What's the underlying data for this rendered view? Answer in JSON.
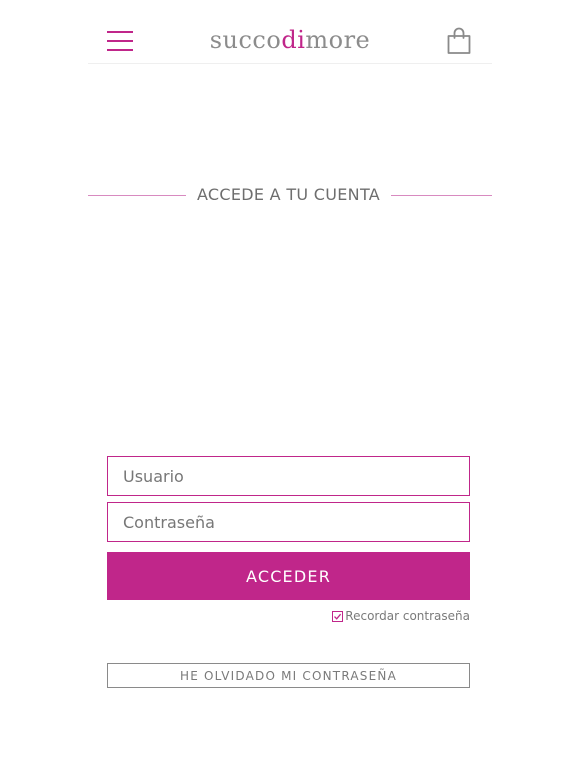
{
  "header": {
    "logo_part1": "succo",
    "logo_part2": "di",
    "logo_part3": "more"
  },
  "login": {
    "heading": "ACCEDE A TU CUENTA",
    "username_placeholder": "Usuario",
    "password_placeholder": "Contraseña",
    "submit_label": "ACCEDER",
    "remember_label": "Recordar contraseña",
    "remember_checked": true,
    "forgot_label": "HE OLVIDADO MI CONTRASEÑA"
  },
  "colors": {
    "accent": "#c0268a",
    "text": "#6b6b6b",
    "background": "#ffffff"
  },
  "icons": {
    "menu": "hamburger-menu-icon",
    "cart": "shopping-bag-icon",
    "checkbox": "checkbox-checked-icon"
  }
}
